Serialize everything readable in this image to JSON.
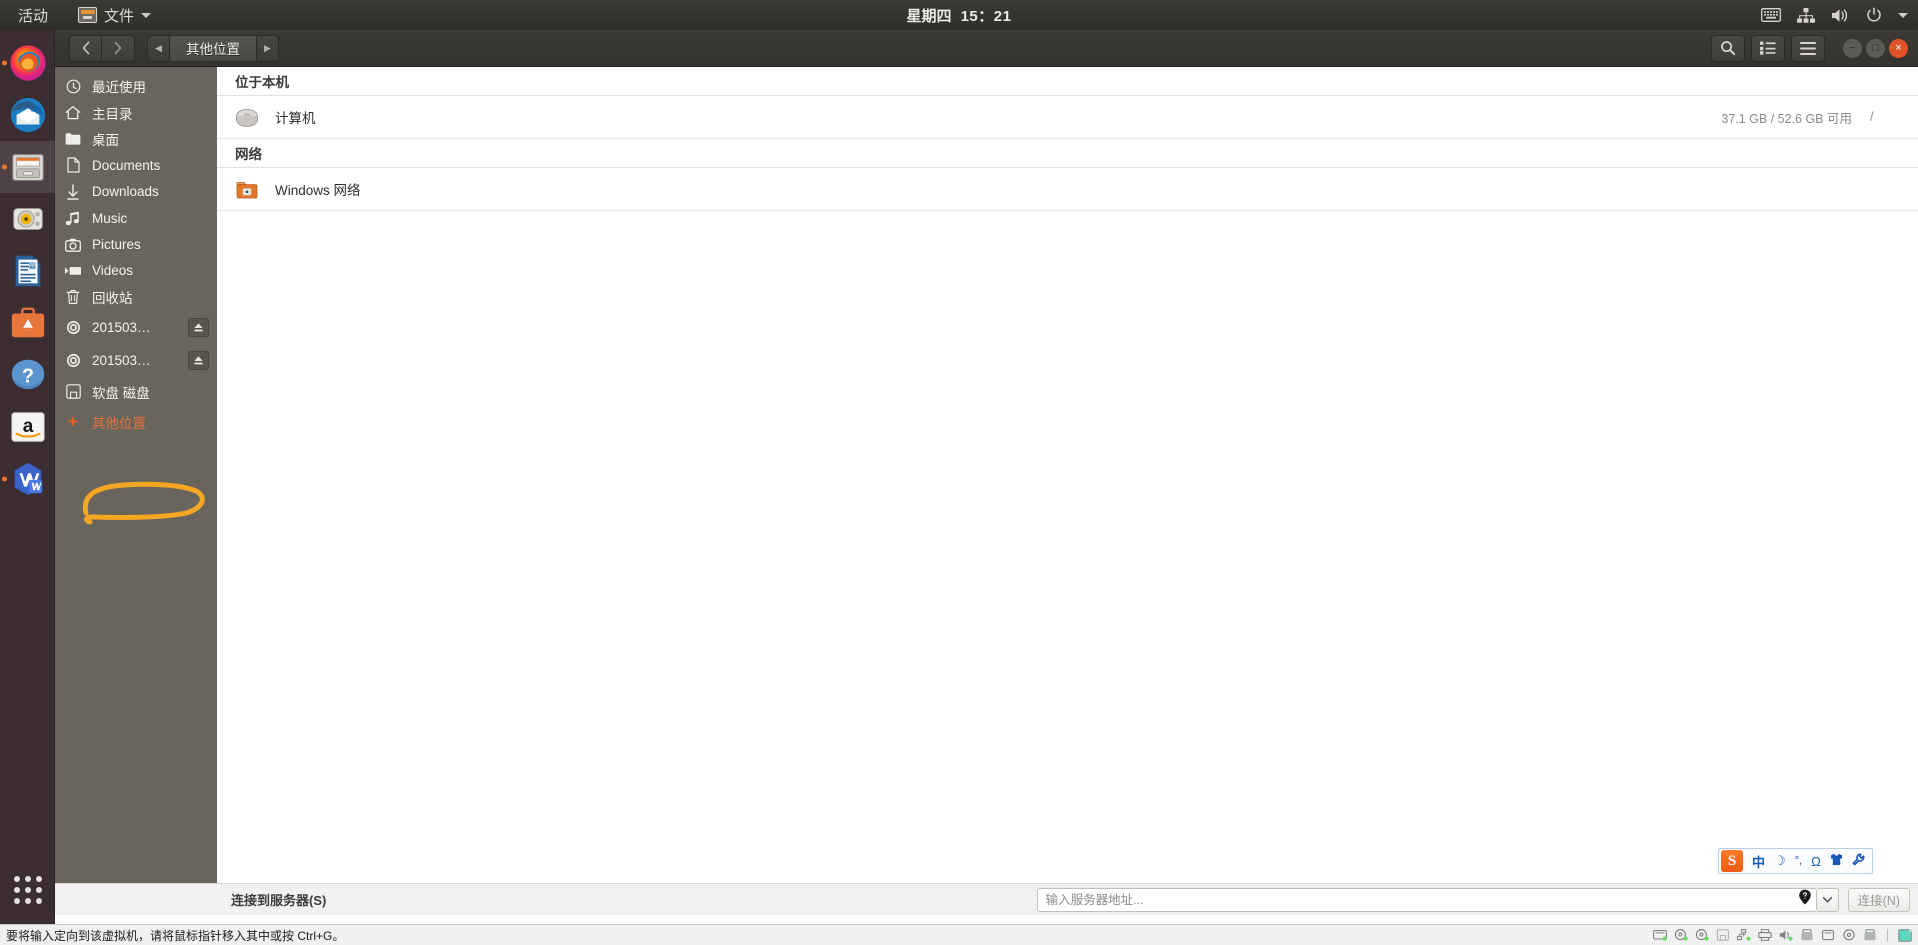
{
  "topbar": {
    "activities_label": "活动",
    "app_menu_label": "文件",
    "app_menu_icon": "files-icon",
    "caret_icon": "chevron-down-icon",
    "date": "星期四",
    "time": "15：21",
    "indicators": [
      "keyboard-icon",
      "network-icon",
      "volume-icon",
      "power-icon",
      "chevron-down-icon"
    ]
  },
  "dock": {
    "items": [
      {
        "name": "firefox",
        "label": "Firefox",
        "running": true,
        "active": false
      },
      {
        "name": "thunderbird",
        "label": "Thunderbird",
        "running": false,
        "active": false
      },
      {
        "name": "files",
        "label": "文件",
        "running": true,
        "active": true
      },
      {
        "name": "rhythmbox",
        "label": "Rhythmbox",
        "running": false,
        "active": false
      },
      {
        "name": "libreoffice-writer",
        "label": "LibreOffice Writer",
        "running": false,
        "active": false
      },
      {
        "name": "ubuntu-software",
        "label": "Ubuntu Software",
        "running": false,
        "active": false
      },
      {
        "name": "help",
        "label": "帮助",
        "running": false,
        "active": false
      },
      {
        "name": "amazon",
        "label": "Amazon",
        "running": false,
        "active": false
      },
      {
        "name": "wps-office",
        "label": "WPS Office",
        "running": true,
        "active": false
      }
    ],
    "app_grid_label": "显示应用程序"
  },
  "window": {
    "headerbar": {
      "back_label": "‹",
      "forward_label": "›",
      "path_prev_label": "◀",
      "path_next_label": "▶",
      "breadcrumb": "其他位置",
      "search_icon": "search-icon",
      "view_icon": "list-view-icon",
      "menu_icon": "hamburger-menu-icon",
      "minimize_label": "−",
      "maximize_label": "□",
      "close_label": "×"
    },
    "sidebar": {
      "items": [
        {
          "label": "最近使用",
          "icon": "clock-icon",
          "eject": false,
          "selected": false
        },
        {
          "label": "主目录",
          "icon": "home-icon",
          "eject": false,
          "selected": false
        },
        {
          "label": "桌面",
          "icon": "folder-icon",
          "eject": false,
          "selected": false
        },
        {
          "label": "Documents",
          "icon": "document-icon",
          "eject": false,
          "selected": false
        },
        {
          "label": "Downloads",
          "icon": "download-icon",
          "eject": false,
          "selected": false
        },
        {
          "label": "Music",
          "icon": "music-icon",
          "eject": false,
          "selected": false
        },
        {
          "label": "Pictures",
          "icon": "camera-icon",
          "eject": false,
          "selected": false
        },
        {
          "label": "Videos",
          "icon": "video-icon",
          "eject": false,
          "selected": false
        },
        {
          "label": "回收站",
          "icon": "trash-icon",
          "eject": false,
          "selected": false
        },
        {
          "label": "201503…",
          "icon": "disc-icon",
          "eject": true,
          "selected": false
        },
        {
          "label": "201503…",
          "icon": "disc-icon",
          "eject": true,
          "selected": false
        },
        {
          "label": "软盘 磁盘",
          "icon": "floppy-icon",
          "eject": false,
          "selected": false
        },
        {
          "label": "其他位置",
          "icon": "plus-icon",
          "eject": false,
          "selected": true
        }
      ]
    },
    "content": {
      "sections": [
        {
          "title": "位于本机",
          "rows": [
            {
              "name": "计算机",
              "icon": "hard-drive-icon",
              "free": "37.1 GB / 52.6 GB 可用",
              "mount": "/"
            }
          ]
        },
        {
          "title": "网络",
          "rows": [
            {
              "name": "Windows 网络",
              "icon": "network-folder-icon",
              "free": "",
              "mount": ""
            }
          ]
        }
      ]
    },
    "footer": {
      "label": "连接到服务器(S)",
      "address_value": "",
      "address_placeholder": "输入服务器地址...",
      "help_icon": "help-pin-icon",
      "dropdown_icon": "chevron-down-icon",
      "connect_label": "连接(N)"
    }
  },
  "ime": {
    "logo_label": "S",
    "buttons": [
      "中",
      "☽",
      "°,",
      "Ω",
      "👕",
      "🔧"
    ],
    "button_names": [
      "chinese-mode-icon",
      "moon-icon",
      "punctuation-icon",
      "symbol-icon",
      "skin-icon",
      "settings-icon"
    ]
  },
  "annotation": {
    "shape": "hand-drawn-highlight-loop",
    "color": "#f5a623",
    "target": "其他位置"
  },
  "vmbar": {
    "message": "要将输入定向到该虚拟机，请将鼠标指针移入其中或按 Ctrl+G。",
    "devices": [
      "hard-disk-icon",
      "cd-drive-icon",
      "cd-drive-icon",
      "floppy-icon",
      "network-icon",
      "printer-icon",
      "sound-icon",
      "usb-icon",
      "usb-storage-icon",
      "disc-icon",
      "usb-icon",
      "display-icon"
    ]
  }
}
